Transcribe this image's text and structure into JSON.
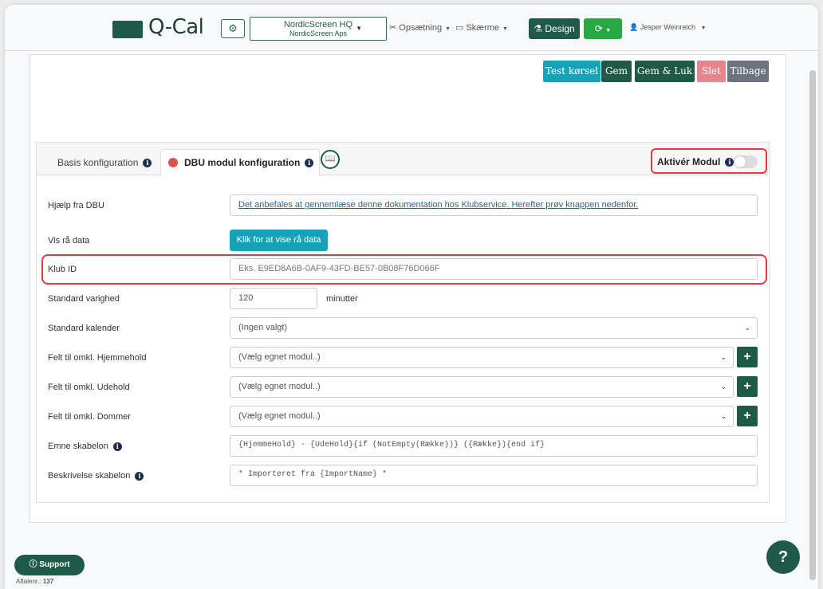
{
  "navbar": {
    "logo_text": "Q-Cal",
    "cog_icon": "⚙",
    "tenant_name": "NordicScreen HQ",
    "tenant_sub": "NordicScreen Aps",
    "setup_menu": "Opsætning",
    "screens_menu": "Skærme",
    "design_button": "Design",
    "user_name": "Jesper Weinreich"
  },
  "toolbar": {
    "test_label": "Test kørsel",
    "save_label": "Gem",
    "save_close_label": "Gem & Luk",
    "delete_label": "Slet",
    "back_label": "Tilbage"
  },
  "tabs": {
    "basis": "Basis konfiguration",
    "dbu": "DBU modul konfiguration",
    "activate_label": "Aktivér Modul",
    "activate_state": false
  },
  "form": {
    "help_label": "Hjælp fra DBU",
    "help_link": "Det anbefales at gennemlæse denne dokumentation hos Klubservice. Herefter prøv knappen nedenfor.",
    "raw_label": "Vis rå data",
    "raw_button": "Klik for at vise rå data",
    "klub_label": "Klub ID",
    "klub_placeholder": "Eks. E9ED8A6B-0AF9-43FD-BE57-0B08F76D066F",
    "duration_label": "Standard varighed",
    "duration_value": "120",
    "duration_unit": "minutter",
    "calendar_label": "Standard kalender",
    "calendar_value": "(Ingen valgt)",
    "home_label": "Felt til omkl. Hjemmehold",
    "home_value": "(Vælg egnet modul..)",
    "away_label": "Felt til omkl. Udehold",
    "away_value": "(Vælg egnet modul..)",
    "ref_label": "Felt til omkl. Dommer",
    "ref_value": "(Vælg egnet modul..)",
    "subject_label": "Emne skabelon",
    "subject_value": "{HjemmeHold} - {UdeHold}{if (NotEmpty(Række))} ({Række}){end if}",
    "desc_label": "Beskrivelse skabelon",
    "desc_value": "* Importeret fra {ImportName} *"
  },
  "footer": {
    "support_label": "Support",
    "agreement_label": "Aftalenr.:",
    "agreement_number": "137",
    "help_label": "?"
  },
  "colors": {
    "primary": "#1f5a48",
    "info": "#17a2b8",
    "success": "#28a745",
    "danger": "#e8848c",
    "secondary": "#6c757d",
    "highlight": "#e03a4a"
  }
}
